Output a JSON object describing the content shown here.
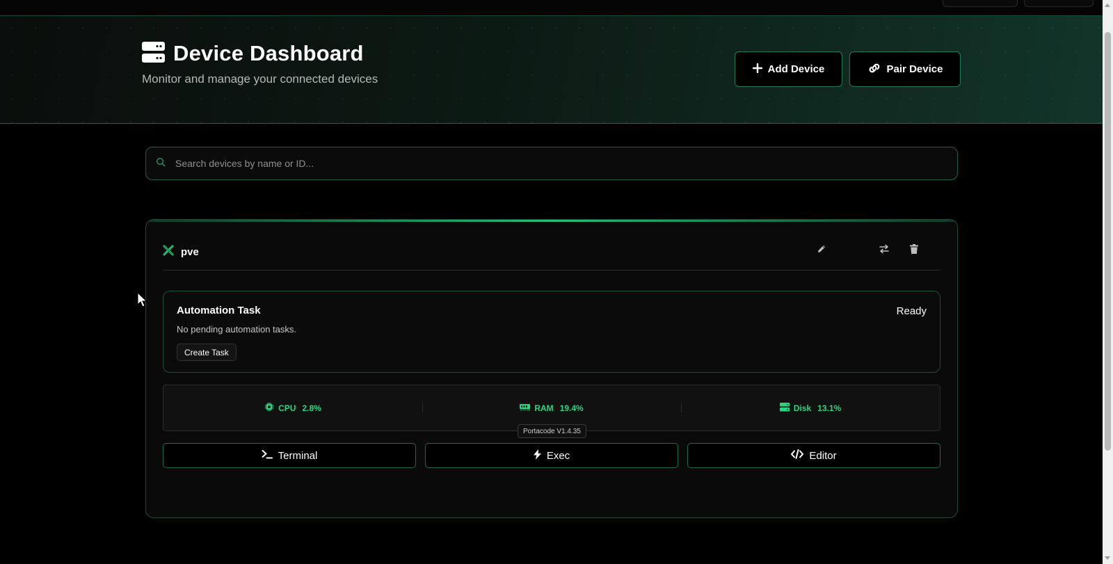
{
  "header": {
    "title": "Device Dashboard",
    "subtitle": "Monitor and manage your connected devices",
    "title_icon": "server-icon",
    "add_device_label": "Add Device",
    "pair_device_label": "Pair Device"
  },
  "search": {
    "placeholder": "Search devices by name or ID...",
    "value": ""
  },
  "device": {
    "name": "pve",
    "status_icon": "x-icon",
    "actions": [
      "edit-icon",
      "swap-icon",
      "trash-icon"
    ],
    "task": {
      "title": "Automation Task",
      "status": "Ready",
      "description": "No pending automation tasks.",
      "button_label": "Create Task"
    },
    "stats": [
      {
        "label": "CPU",
        "value": "2.8%",
        "icon": "cpu-icon"
      },
      {
        "label": "RAM",
        "value": "19.4%",
        "icon": "memory-icon"
      },
      {
        "label": "Disk",
        "value": "13.1%",
        "icon": "disk-icon"
      }
    ],
    "tooltip": "Portacode V1.4.35",
    "buttons": {
      "terminal": "Terminal",
      "exec": "Exec",
      "editor": "Editor"
    }
  },
  "colors": {
    "accent": "#23d97f",
    "border": "#1f6a49",
    "background": "#000000"
  }
}
